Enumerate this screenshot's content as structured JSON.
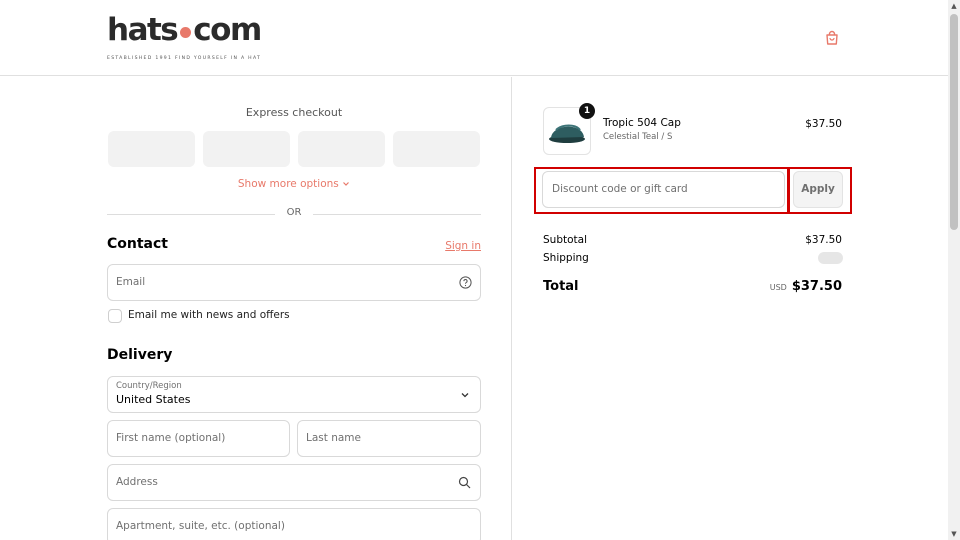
{
  "header": {
    "logo_left": "hats",
    "logo_right": "com",
    "logo_tagline": "ESTABLISHED    1991    FIND YOURSELF IN A HAT",
    "cart_icon": "shopping-bag-icon"
  },
  "express": {
    "title": "Express checkout",
    "show_more": "Show more options",
    "or": "OR"
  },
  "contact": {
    "title": "Contact",
    "sign_in": "Sign in",
    "email_placeholder": "Email",
    "newsletter_label": "Email me with news and offers"
  },
  "delivery": {
    "title": "Delivery",
    "country_label": "Country/Region",
    "country_value": "United States",
    "first_name_placeholder": "First name (optional)",
    "last_name_placeholder": "Last name",
    "address_placeholder": "Address",
    "apartment_placeholder": "Apartment, suite, etc. (optional)"
  },
  "summary": {
    "product": {
      "quantity": "1",
      "name": "Tropic 504 Cap",
      "variant": "Celestial Teal / S",
      "price": "$37.50"
    },
    "discount_placeholder": "Discount code or gift card",
    "apply_label": "Apply",
    "subtotal_label": "Subtotal",
    "subtotal_value": "$37.50",
    "shipping_label": "Shipping",
    "total_label": "Total",
    "currency": "USD",
    "total_value": "$37.50"
  },
  "colors": {
    "accent": "#e8796a",
    "highlight": "#d10000"
  }
}
